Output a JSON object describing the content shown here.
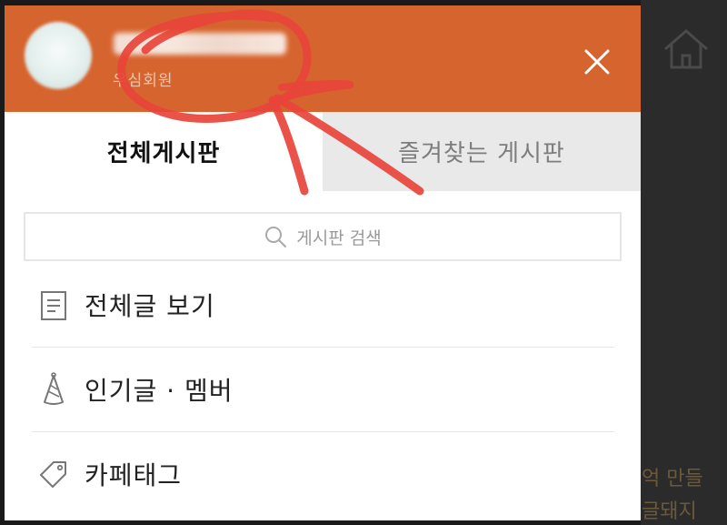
{
  "background": {
    "text_line_1": "억 만들",
    "text_line_2": "글돼지"
  },
  "drawer": {
    "header": {
      "member_level": "우심회원",
      "accent_color": "#d6642f"
    },
    "tabs": [
      {
        "label": "전체게시판",
        "active": true
      },
      {
        "label": "즐겨찾는 게시판",
        "active": false
      }
    ],
    "search": {
      "placeholder": "게시판 검색"
    },
    "menu": [
      {
        "label": "전체글 보기",
        "icon": "document-icon"
      },
      {
        "label": "인기글 · 멤버",
        "icon": "party-hat-icon"
      },
      {
        "label": "카페태그",
        "icon": "tag-icon"
      }
    ]
  },
  "annotation": {
    "color": "#e8443a"
  }
}
